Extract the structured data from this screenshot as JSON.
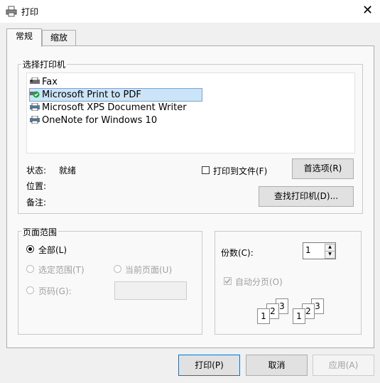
{
  "window": {
    "title": "打印",
    "close_glyph": "✕"
  },
  "tabs": [
    {
      "label": "常规"
    },
    {
      "label": "缩放"
    }
  ],
  "select_printer": {
    "legend": "选择打印机",
    "printers": [
      {
        "name": "Fax"
      },
      {
        "name": "Microsoft Print to PDF",
        "selected": true
      },
      {
        "name": "Microsoft XPS Document Writer"
      },
      {
        "name": "OneNote for Windows 10"
      }
    ],
    "status_label": "状态:",
    "status_value": "就绪",
    "location_label": "位置:",
    "comment_label": "备注:",
    "print_to_file_label": "打印到文件(F)",
    "preferences_button": "首选项(R)",
    "find_printer_button": "查找打印机(D)..."
  },
  "page_range": {
    "legend": "页面范围",
    "all_label": "全部(L)",
    "selection_label": "选定范围(T)",
    "current_page_label": "当前页面(U)",
    "pages_label": "页码(G):"
  },
  "copies": {
    "label": "份数(C):",
    "value": "1",
    "collate_label": "自动分页(O)",
    "collate_numbers": [
      "1",
      "2",
      "3"
    ]
  },
  "footer": {
    "print_button": "打印(P)",
    "cancel_button": "取消",
    "apply_button": "应用(A)"
  },
  "colors": {
    "selection": "#cce4f7",
    "accent": "#0078d7",
    "checkmark_green": "#1aa34a"
  }
}
